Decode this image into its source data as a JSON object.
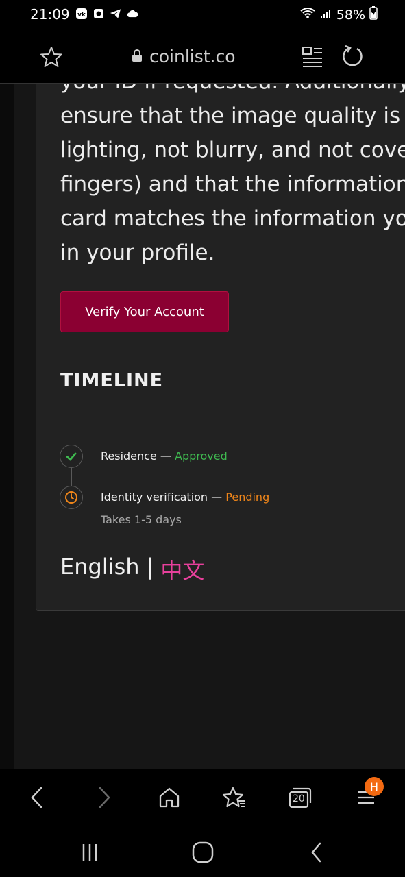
{
  "status_bar": {
    "time": "21:09",
    "battery": "58%",
    "icons": [
      "vk-icon",
      "camera-icon",
      "telegram-icon",
      "cloud-icon",
      "wifi-icon",
      "signal-icon",
      "battery-icon"
    ]
  },
  "browser": {
    "url": "coinlist.co"
  },
  "content": {
    "paragraph_lines": [
      "your ID if requested. Additionally,",
      "ensure that the image quality is g",
      "lighting, not blurry, and not cover",
      "fingers) and that the information",
      "card matches the information yo",
      "in your profile."
    ],
    "verify_button": "Verify Your Account",
    "timeline_title": "TIMELINE",
    "timeline": [
      {
        "label": "Residence",
        "separator": "—",
        "status": "Approved",
        "status_color": "#3fb950"
      },
      {
        "label": "Identity verification",
        "separator": "—",
        "status": "Pending",
        "status_color": "#f0861a",
        "note": "Takes 1-5 days"
      }
    ],
    "language": {
      "english": "English",
      "separator": "|",
      "chinese": "中文"
    }
  },
  "toolbar": {
    "tabs_count": "20",
    "menu_badge": "H"
  },
  "colors": {
    "accent_button": "#8b0032",
    "approved": "#3fb950",
    "pending": "#f0861a",
    "chinese_link": "#e8409c",
    "badge": "#f36a12"
  }
}
